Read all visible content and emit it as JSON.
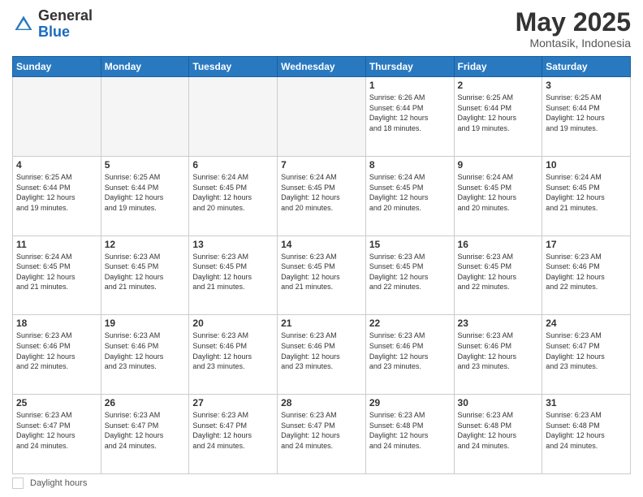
{
  "logo": {
    "general": "General",
    "blue": "Blue"
  },
  "title": "May 2025",
  "location": "Montasik, Indonesia",
  "days_of_week": [
    "Sunday",
    "Monday",
    "Tuesday",
    "Wednesday",
    "Thursday",
    "Friday",
    "Saturday"
  ],
  "footer": {
    "label": "Daylight hours"
  },
  "weeks": [
    [
      {
        "day": "",
        "info": ""
      },
      {
        "day": "",
        "info": ""
      },
      {
        "day": "",
        "info": ""
      },
      {
        "day": "",
        "info": ""
      },
      {
        "day": "1",
        "info": "Sunrise: 6:26 AM\nSunset: 6:44 PM\nDaylight: 12 hours\nand 18 minutes."
      },
      {
        "day": "2",
        "info": "Sunrise: 6:25 AM\nSunset: 6:44 PM\nDaylight: 12 hours\nand 19 minutes."
      },
      {
        "day": "3",
        "info": "Sunrise: 6:25 AM\nSunset: 6:44 PM\nDaylight: 12 hours\nand 19 minutes."
      }
    ],
    [
      {
        "day": "4",
        "info": "Sunrise: 6:25 AM\nSunset: 6:44 PM\nDaylight: 12 hours\nand 19 minutes."
      },
      {
        "day": "5",
        "info": "Sunrise: 6:25 AM\nSunset: 6:44 PM\nDaylight: 12 hours\nand 19 minutes."
      },
      {
        "day": "6",
        "info": "Sunrise: 6:24 AM\nSunset: 6:45 PM\nDaylight: 12 hours\nand 20 minutes."
      },
      {
        "day": "7",
        "info": "Sunrise: 6:24 AM\nSunset: 6:45 PM\nDaylight: 12 hours\nand 20 minutes."
      },
      {
        "day": "8",
        "info": "Sunrise: 6:24 AM\nSunset: 6:45 PM\nDaylight: 12 hours\nand 20 minutes."
      },
      {
        "day": "9",
        "info": "Sunrise: 6:24 AM\nSunset: 6:45 PM\nDaylight: 12 hours\nand 20 minutes."
      },
      {
        "day": "10",
        "info": "Sunrise: 6:24 AM\nSunset: 6:45 PM\nDaylight: 12 hours\nand 21 minutes."
      }
    ],
    [
      {
        "day": "11",
        "info": "Sunrise: 6:24 AM\nSunset: 6:45 PM\nDaylight: 12 hours\nand 21 minutes."
      },
      {
        "day": "12",
        "info": "Sunrise: 6:23 AM\nSunset: 6:45 PM\nDaylight: 12 hours\nand 21 minutes."
      },
      {
        "day": "13",
        "info": "Sunrise: 6:23 AM\nSunset: 6:45 PM\nDaylight: 12 hours\nand 21 minutes."
      },
      {
        "day": "14",
        "info": "Sunrise: 6:23 AM\nSunset: 6:45 PM\nDaylight: 12 hours\nand 21 minutes."
      },
      {
        "day": "15",
        "info": "Sunrise: 6:23 AM\nSunset: 6:45 PM\nDaylight: 12 hours\nand 22 minutes."
      },
      {
        "day": "16",
        "info": "Sunrise: 6:23 AM\nSunset: 6:45 PM\nDaylight: 12 hours\nand 22 minutes."
      },
      {
        "day": "17",
        "info": "Sunrise: 6:23 AM\nSunset: 6:46 PM\nDaylight: 12 hours\nand 22 minutes."
      }
    ],
    [
      {
        "day": "18",
        "info": "Sunrise: 6:23 AM\nSunset: 6:46 PM\nDaylight: 12 hours\nand 22 minutes."
      },
      {
        "day": "19",
        "info": "Sunrise: 6:23 AM\nSunset: 6:46 PM\nDaylight: 12 hours\nand 23 minutes."
      },
      {
        "day": "20",
        "info": "Sunrise: 6:23 AM\nSunset: 6:46 PM\nDaylight: 12 hours\nand 23 minutes."
      },
      {
        "day": "21",
        "info": "Sunrise: 6:23 AM\nSunset: 6:46 PM\nDaylight: 12 hours\nand 23 minutes."
      },
      {
        "day": "22",
        "info": "Sunrise: 6:23 AM\nSunset: 6:46 PM\nDaylight: 12 hours\nand 23 minutes."
      },
      {
        "day": "23",
        "info": "Sunrise: 6:23 AM\nSunset: 6:46 PM\nDaylight: 12 hours\nand 23 minutes."
      },
      {
        "day": "24",
        "info": "Sunrise: 6:23 AM\nSunset: 6:47 PM\nDaylight: 12 hours\nand 23 minutes."
      }
    ],
    [
      {
        "day": "25",
        "info": "Sunrise: 6:23 AM\nSunset: 6:47 PM\nDaylight: 12 hours\nand 24 minutes."
      },
      {
        "day": "26",
        "info": "Sunrise: 6:23 AM\nSunset: 6:47 PM\nDaylight: 12 hours\nand 24 minutes."
      },
      {
        "day": "27",
        "info": "Sunrise: 6:23 AM\nSunset: 6:47 PM\nDaylight: 12 hours\nand 24 minutes."
      },
      {
        "day": "28",
        "info": "Sunrise: 6:23 AM\nSunset: 6:47 PM\nDaylight: 12 hours\nand 24 minutes."
      },
      {
        "day": "29",
        "info": "Sunrise: 6:23 AM\nSunset: 6:48 PM\nDaylight: 12 hours\nand 24 minutes."
      },
      {
        "day": "30",
        "info": "Sunrise: 6:23 AM\nSunset: 6:48 PM\nDaylight: 12 hours\nand 24 minutes."
      },
      {
        "day": "31",
        "info": "Sunrise: 6:23 AM\nSunset: 6:48 PM\nDaylight: 12 hours\nand 24 minutes."
      }
    ]
  ]
}
